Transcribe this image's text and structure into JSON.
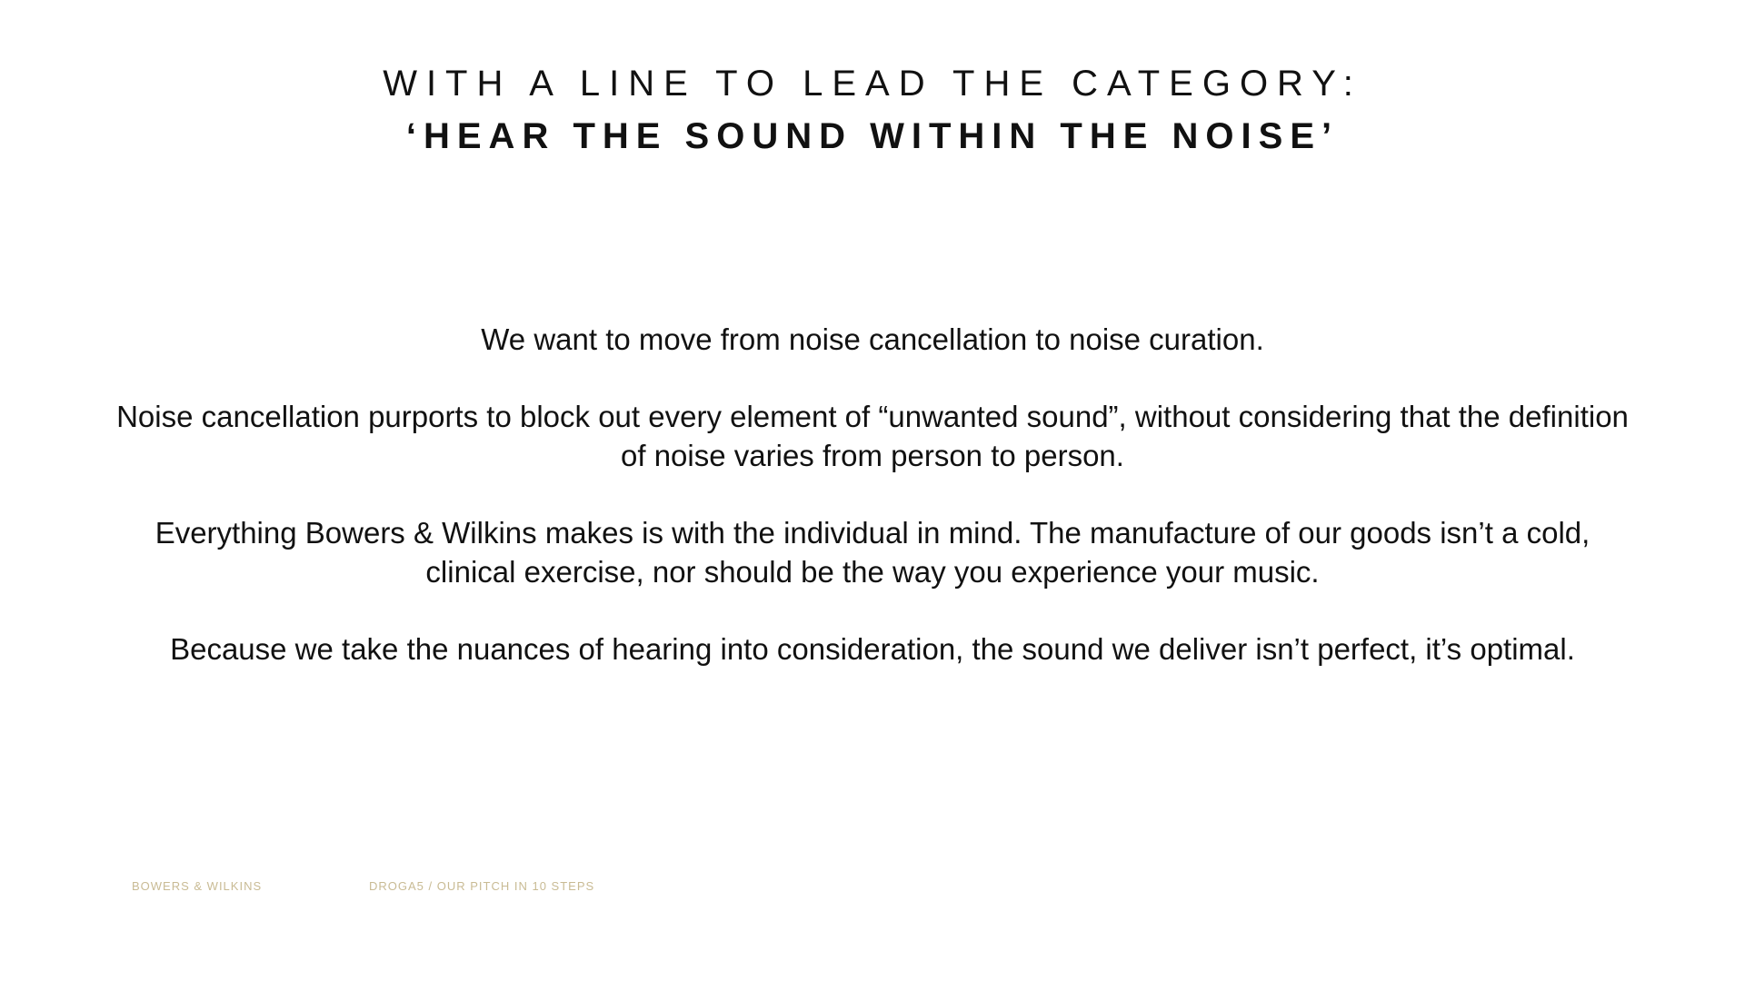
{
  "heading": {
    "line1": "WITH A LINE TO LEAD THE CATEGORY:",
    "line2": "‘HEAR THE SOUND WITHIN THE NOISE’"
  },
  "body": {
    "paragraphs": [
      "We want to move from noise cancellation to noise curation.",
      "Noise cancellation purports to block out every element of “unwanted sound”, without considering that the definition of noise varies from person to person.",
      "Everything Bowers & Wilkins makes is with the individual in mind. The manufacture of our goods isn’t a cold, clinical exercise, nor should be the way you experience your music.",
      "Because we take the nuances of hearing into consideration, the sound we deliver isn’t perfect, it’s optimal."
    ]
  },
  "footer": {
    "brand": "BOWERS & WILKINS",
    "pitch": "DROGA5 / OUR PITCH IN 10 STEPS"
  },
  "colors": {
    "text": "#111111",
    "footer": "#c9bb94",
    "background": "#ffffff"
  }
}
